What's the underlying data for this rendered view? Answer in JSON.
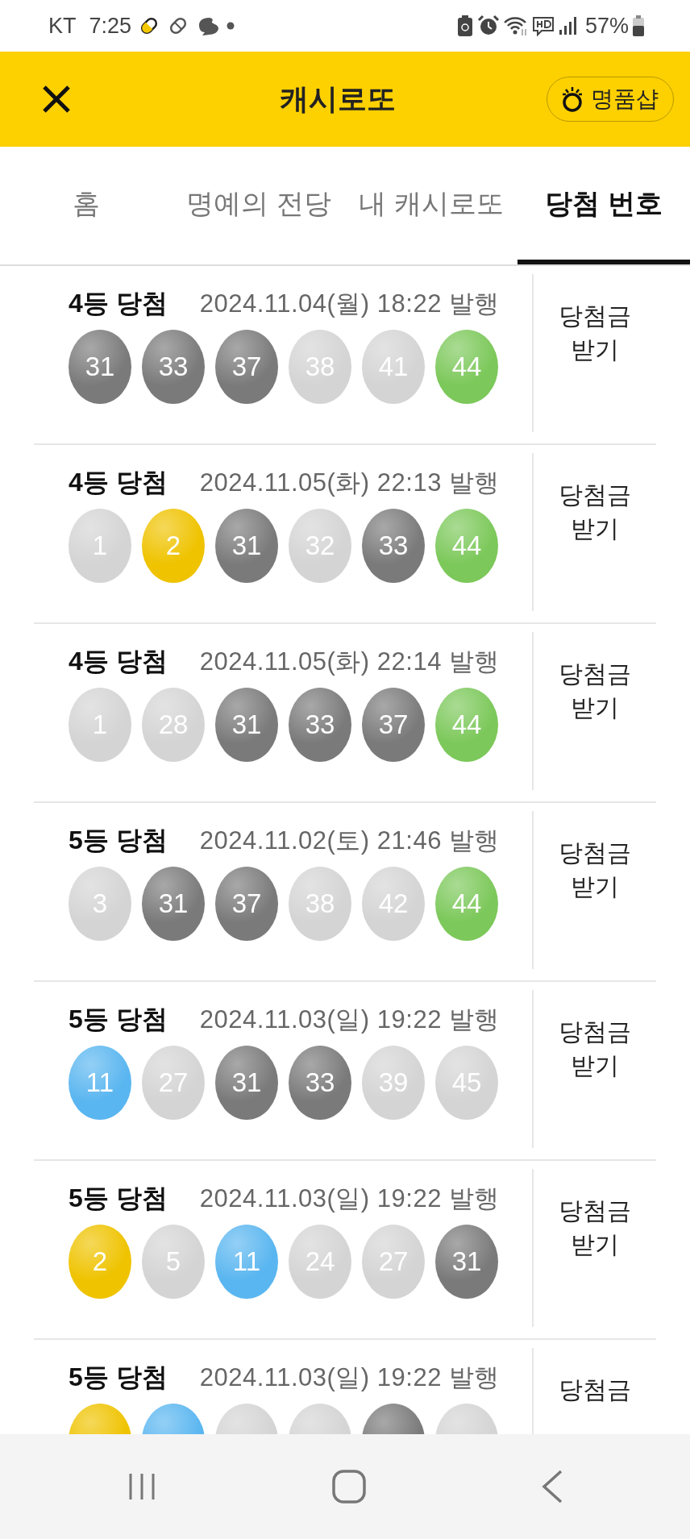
{
  "status_bar": {
    "carrier": "KT",
    "time": "7:25",
    "battery": "57%"
  },
  "header": {
    "title": "캐시로또",
    "shop_button": "명품샵"
  },
  "tabs": [
    {
      "label": "홈",
      "selected": false
    },
    {
      "label": "명예의 전당",
      "selected": false
    },
    {
      "label": "내 캐시로또",
      "selected": false
    },
    {
      "label": "당첨 번호",
      "selected": true
    }
  ],
  "tickets": [
    {
      "rank": "4등 당첨",
      "issued": "2024.11.04(월) 18:22 발행",
      "claim": "당첨금\n받기",
      "balls": [
        {
          "number": "31",
          "color": "#7a7a7a"
        },
        {
          "number": "33",
          "color": "#7a7a7a"
        },
        {
          "number": "37",
          "color": "#7a7a7a"
        },
        {
          "number": "38",
          "color": "#d4d4d4"
        },
        {
          "number": "41",
          "color": "#d4d4d4"
        },
        {
          "number": "44",
          "color": "#7cc85a"
        }
      ]
    },
    {
      "rank": "4등 당첨",
      "issued": "2024.11.05(화) 22:13 발행",
      "claim": "당첨금\n받기",
      "balls": [
        {
          "number": "1",
          "color": "#d4d4d4"
        },
        {
          "number": "2",
          "color": "#efc300"
        },
        {
          "number": "31",
          "color": "#7a7a7a"
        },
        {
          "number": "32",
          "color": "#d4d4d4"
        },
        {
          "number": "33",
          "color": "#7a7a7a"
        },
        {
          "number": "44",
          "color": "#7cc85a"
        }
      ]
    },
    {
      "rank": "4등 당첨",
      "issued": "2024.11.05(화) 22:14 발행",
      "claim": "당첨금\n받기",
      "balls": [
        {
          "number": "1",
          "color": "#d4d4d4"
        },
        {
          "number": "28",
          "color": "#d4d4d4"
        },
        {
          "number": "31",
          "color": "#7a7a7a"
        },
        {
          "number": "33",
          "color": "#7a7a7a"
        },
        {
          "number": "37",
          "color": "#7a7a7a"
        },
        {
          "number": "44",
          "color": "#7cc85a"
        }
      ]
    },
    {
      "rank": "5등 당첨",
      "issued": "2024.11.02(토) 21:46 발행",
      "claim": "당첨금\n받기",
      "balls": [
        {
          "number": "3",
          "color": "#d4d4d4"
        },
        {
          "number": "31",
          "color": "#7a7a7a"
        },
        {
          "number": "37",
          "color": "#7a7a7a"
        },
        {
          "number": "38",
          "color": "#d4d4d4"
        },
        {
          "number": "42",
          "color": "#d4d4d4"
        },
        {
          "number": "44",
          "color": "#7cc85a"
        }
      ]
    },
    {
      "rank": "5등 당첨",
      "issued": "2024.11.03(일) 19:22 발행",
      "claim": "당첨금\n받기",
      "balls": [
        {
          "number": "11",
          "color": "#5ab6f0"
        },
        {
          "number": "27",
          "color": "#d4d4d4"
        },
        {
          "number": "31",
          "color": "#7a7a7a"
        },
        {
          "number": "33",
          "color": "#7a7a7a"
        },
        {
          "number": "39",
          "color": "#d4d4d4"
        },
        {
          "number": "45",
          "color": "#d4d4d4"
        }
      ]
    },
    {
      "rank": "5등 당첨",
      "issued": "2024.11.03(일) 19:22 발행",
      "claim": "당첨금\n받기",
      "balls": [
        {
          "number": "2",
          "color": "#efc300"
        },
        {
          "number": "5",
          "color": "#d4d4d4"
        },
        {
          "number": "11",
          "color": "#5ab6f0"
        },
        {
          "number": "24",
          "color": "#d4d4d4"
        },
        {
          "number": "27",
          "color": "#d4d4d4"
        },
        {
          "number": "31",
          "color": "#7a7a7a"
        }
      ]
    },
    {
      "rank": "5등 당첨",
      "issued": "2024.11.03(일) 19:22 발행",
      "claim": "당첨금",
      "balls": [
        {
          "color": "#efc300"
        },
        {
          "color": "#5ab6f0"
        },
        {
          "color": "#d4d4d4"
        },
        {
          "color": "#d4d4d4"
        },
        {
          "color": "#7a7a7a"
        },
        {
          "color": "#d4d4d4"
        }
      ]
    }
  ]
}
